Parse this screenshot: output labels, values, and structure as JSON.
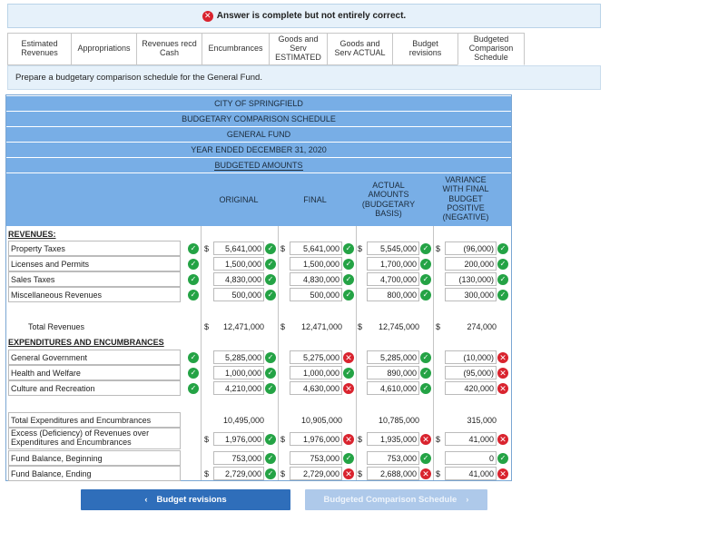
{
  "banner": {
    "text": "Answer is complete but not entirely correct."
  },
  "tabs": [
    {
      "label": "Estimated Revenues"
    },
    {
      "label": "Appropriations"
    },
    {
      "label": "Revenues recd Cash"
    },
    {
      "label": "Encumbrances"
    },
    {
      "label": "Goods and Serv ESTIMATED"
    },
    {
      "label": "Goods and Serv ACTUAL"
    },
    {
      "label": "Budget revisions"
    },
    {
      "label": "Budgeted Comparison Schedule"
    }
  ],
  "prompt": "Prepare a budgetary comparison schedule for the General Fund.",
  "schedule": {
    "city": "CITY OF SPRINGFIELD",
    "title": "BUDGETARY COMPARISON SCHEDULE",
    "fund": "GENERAL FUND",
    "period": "YEAR ENDED DECEMBER 31, 2020",
    "budgeted_amounts": "BUDGETED AMOUNTS",
    "col_original": "ORIGINAL",
    "col_final": "FINAL",
    "col_actual": "ACTUAL AMOUNTS (BUDGETARY BASIS)",
    "col_variance": "VARIANCE WITH FINAL BUDGET POSITIVE (NEGATIVE)",
    "revenues_head": "REVENUES:",
    "expenditures_head": "EXPENDITURES AND ENCUMBRANCES",
    "dollar": "$",
    "revenues": [
      {
        "label": "Property Taxes",
        "original": "5,641,000",
        "final": "5,641,000",
        "actual": "5,545,000",
        "variance": "(96,000)"
      },
      {
        "label": "Licenses and Permits",
        "original": "1,500,000",
        "final": "1,500,000",
        "actual": "1,700,000",
        "variance": "200,000"
      },
      {
        "label": "Sales Taxes",
        "original": "4,830,000",
        "final": "4,830,000",
        "actual": "4,700,000",
        "variance": "(130,000)"
      },
      {
        "label": "Miscellaneous Revenues",
        "original": "500,000",
        "final": "500,000",
        "actual": "800,000",
        "variance": "300,000"
      }
    ],
    "total_revenues": {
      "label": "Total Revenues",
      "original": "12,471,000",
      "final": "12,471,000",
      "actual": "12,745,000",
      "variance": "274,000"
    },
    "expenditures": [
      {
        "label": "General Government",
        "original": "5,285,000",
        "final": "5,275,000",
        "actual": "5,285,000",
        "variance": "(10,000)"
      },
      {
        "label": "Health and Welfare",
        "original": "1,000,000",
        "final": "1,000,000",
        "actual": "890,000",
        "variance": "(95,000)"
      },
      {
        "label": "Culture and Recreation",
        "original": "4,210,000",
        "final": "4,630,000",
        "actual": "4,610,000",
        "variance": "420,000"
      }
    ],
    "total_expenditures": {
      "label": "Total Expenditures and Encumbrances",
      "original": "10,495,000",
      "final": "10,905,000",
      "actual": "10,785,000",
      "variance": "315,000"
    },
    "excess": {
      "label": "Excess (Deficiency) of Revenues over Expenditures and Encumbrances",
      "original": "1,976,000",
      "final": "1,976,000",
      "actual": "1,935,000",
      "variance": "41,000"
    },
    "fund_begin": {
      "label": "Fund Balance, Beginning",
      "original": "753,000",
      "final": "753,000",
      "actual": "753,000",
      "variance": "0"
    },
    "fund_end": {
      "label": "Fund Balance, Ending",
      "original": "2,729,000",
      "final": "2,729,000",
      "actual": "2,688,000",
      "variance": "41,000"
    }
  },
  "nav": {
    "prev_label": "Budget revisions",
    "next_label": "Budgeted Comparison Schedule"
  },
  "colors": {
    "header_blue": "#78aee6",
    "correct_green": "#24a345",
    "incorrect_red": "#d9232e",
    "button_blue": "#2f6eba"
  }
}
